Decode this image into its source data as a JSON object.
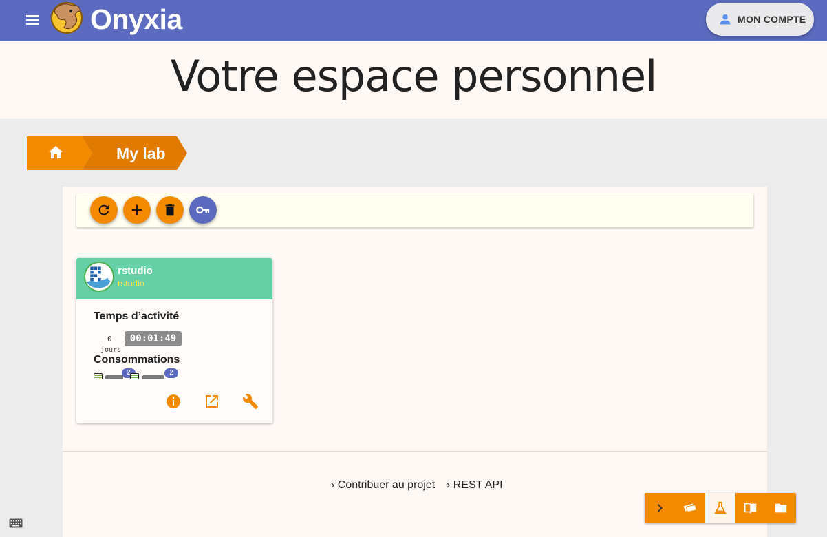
{
  "header": {
    "brand": "Onyxia",
    "account_label": "MON COMPTE"
  },
  "page": {
    "title": "Votre espace personnel"
  },
  "breadcrumb": {
    "current": "My lab"
  },
  "toolbar": {
    "buttons": [
      "refresh-icon",
      "add-icon",
      "delete-icon",
      "key-icon"
    ]
  },
  "service_card": {
    "title": "rstudio",
    "subtitle": "rstudio",
    "uptime_label": "Temps d’activité",
    "days_value": "0",
    "days_label": "jours",
    "timer": "00:01:49",
    "consumption_label": "Consommations",
    "resources": [
      {
        "name": "cpu",
        "count": "2"
      },
      {
        "name": "mem",
        "count": "2"
      }
    ]
  },
  "footer": {
    "links": [
      "› Contribuer au projet",
      "› REST API"
    ]
  },
  "bottom_nav": {
    "items": [
      "chevron-right-icon",
      "cards-icon",
      "flask-icon",
      "book-icon",
      "folder-icon"
    ],
    "active": "flask-icon"
  },
  "colors": {
    "primary": "#5c6bc0",
    "accent": "#f38a00",
    "card_header": "#66cfa6",
    "subtitle": "#ffeb3b"
  }
}
